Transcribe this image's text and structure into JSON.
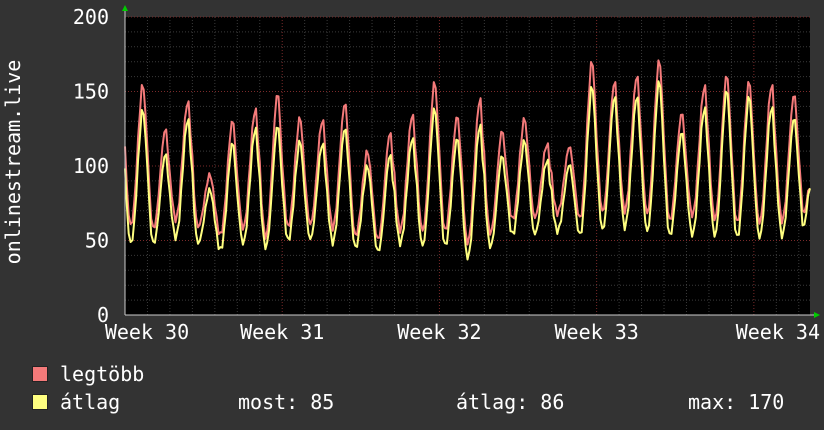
{
  "chart_data": {
    "type": "line",
    "ylabel": "onlinestream.live",
    "ylim": [
      0,
      200
    ],
    "y_ticks": [
      0,
      50,
      100,
      150,
      200
    ],
    "x_ticks": [
      "Week 30",
      "Week 31",
      "Week 32",
      "Week 33",
      "Week 34"
    ],
    "x_range_days": [
      0,
      30.5
    ],
    "series": [
      {
        "name": "legtöbb",
        "color": "#f47a7a",
        "daily_peak": [
          155,
          127,
          147,
          95,
          130,
          138,
          152,
          136,
          132,
          142,
          110,
          125,
          138,
          158,
          133,
          146,
          127,
          135,
          115,
          112,
          172,
          160,
          164,
          172,
          135,
          155,
          165,
          160,
          155,
          148
        ],
        "daily_trough": [
          62,
          58,
          62,
          58,
          55,
          60,
          52,
          57,
          60,
          60,
          55,
          50,
          55,
          56,
          58,
          50,
          54,
          62,
          65,
          70,
          66,
          68,
          68,
          68,
          65,
          68,
          63,
          60,
          62,
          65
        ]
      },
      {
        "name": "átlag",
        "color": "#ffff80",
        "daily_peak": [
          138,
          110,
          135,
          85,
          115,
          125,
          130,
          120,
          116,
          125,
          100,
          110,
          122,
          140,
          118,
          128,
          110,
          120,
          104,
          100,
          155,
          150,
          150,
          158,
          122,
          140,
          155,
          150,
          140,
          132
        ],
        "daily_trough": [
          50,
          48,
          50,
          47,
          45,
          50,
          45,
          48,
          50,
          50,
          47,
          42,
          46,
          46,
          48,
          40,
          45,
          52,
          54,
          58,
          55,
          56,
          57,
          56,
          55,
          55,
          52,
          50,
          52,
          55
        ]
      }
    ],
    "last_value": 85,
    "grid": true
  },
  "legend": {
    "items": [
      {
        "label": "legtöbb",
        "color": "#f47a7a"
      },
      {
        "label": "átlag",
        "color": "#ffff80"
      }
    ],
    "stats": {
      "now": "most:  85",
      "avg": "átlag:  86",
      "max": "max:  170"
    }
  },
  "colors": {
    "background": "#333333",
    "canvas": "#000000",
    "grid_minor": "#3a3a3a",
    "grid_major": "#7a2a2a",
    "axis": "#ffffff",
    "arrow": "#00cc00"
  }
}
